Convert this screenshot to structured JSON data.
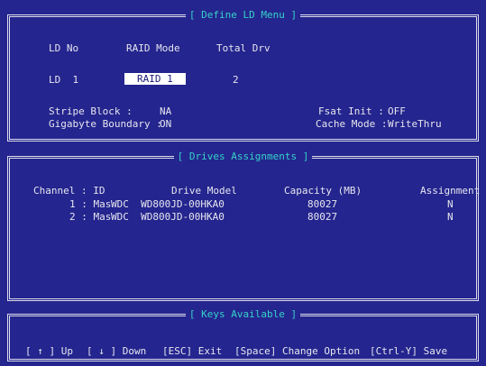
{
  "define_ld": {
    "title": "[ Define LD Menu ]",
    "headers": {
      "ld_no": "LD No",
      "raid_mode": "RAID Mode",
      "total_drv": "Total Drv"
    },
    "row": {
      "ld": "LD  1",
      "raid": "RAID 1",
      "drv": "2"
    },
    "stripe_label": "Stripe Block :",
    "stripe_value": "NA",
    "gigabyte_label": "Gigabyte Boundary :",
    "gigabyte_value": "ON",
    "fsat_label": "Fsat Init :",
    "fsat_value": "OFF",
    "cache_label": "Cache Mode :",
    "cache_value": "WriteThru"
  },
  "drives": {
    "title": "[ Drives Assignments ]",
    "headers": {
      "channel": "Channel : ID",
      "model": "Drive Model",
      "capacity": "Capacity (MB)",
      "assignment": "Assignment"
    },
    "rows": [
      {
        "id": "1 : Mas",
        "model": "WDC  WD800JD-00HKA0",
        "capacity": "80027",
        "assignment": "N"
      },
      {
        "id": "2 : Mas",
        "model": "WDC  WD800JD-00HKA0",
        "capacity": "80027",
        "assignment": "N"
      }
    ]
  },
  "keys": {
    "title": "[ Keys Available ]",
    "up": "[ ↑ ] Up",
    "down": "[ ↓ ] Down",
    "esc": "[ESC] Exit",
    "space": "[Space] Change Option",
    "ctrly": "[Ctrl-Y] Save"
  }
}
